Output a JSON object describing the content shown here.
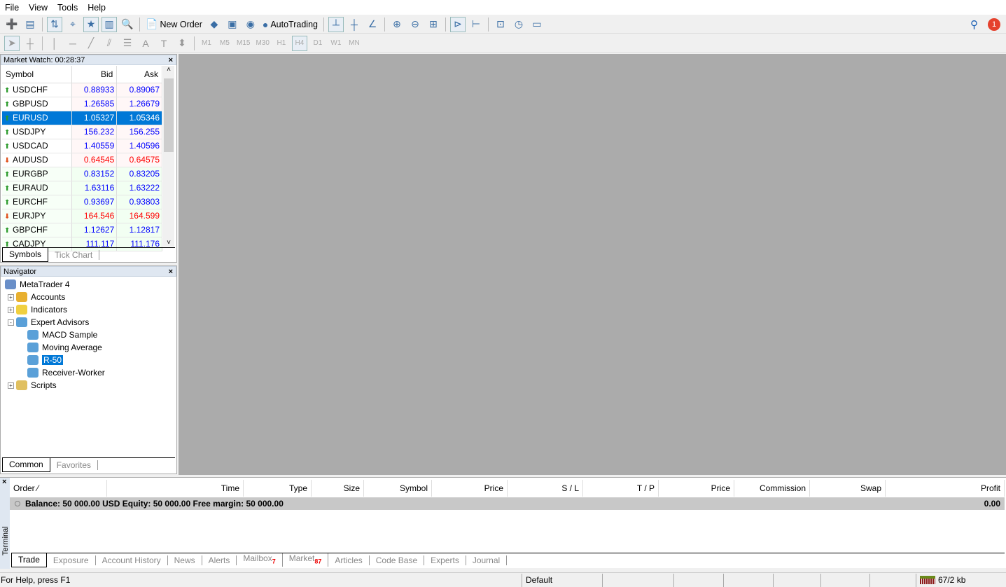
{
  "menu": [
    "File",
    "View",
    "Tools",
    "Help"
  ],
  "toolbar1": [
    {
      "icon": "new-chart-icon",
      "g": "➕"
    },
    {
      "icon": "profiles-icon",
      "g": "▤"
    },
    "sep",
    {
      "icon": "market-watch-icon",
      "g": "⇅",
      "on": true
    },
    {
      "icon": "data-window-icon",
      "g": "⌖"
    },
    {
      "icon": "navigator-icon",
      "g": "★",
      "on": true
    },
    {
      "icon": "terminal-icon",
      "g": "▥",
      "on": true
    },
    {
      "icon": "strategy-tester-icon",
      "g": "🔍"
    },
    "sep",
    {
      "icon": "new-order-icon",
      "g": "📄",
      "label": "New Order"
    },
    {
      "icon": "metaeditor-icon",
      "g": "◆"
    },
    {
      "icon": "options-icon",
      "g": "▣"
    },
    {
      "icon": "signals-icon",
      "g": "◉"
    },
    {
      "icon": "autotrading-icon",
      "g": "●",
      "label": "AutoTrading"
    },
    "sep",
    {
      "icon": "bar-chart-icon",
      "g": "┴",
      "on": true
    },
    {
      "icon": "candlestick-icon",
      "g": "┼"
    },
    {
      "icon": "line-chart-icon",
      "g": "∠"
    },
    "sep",
    {
      "icon": "zoom-in-icon",
      "g": "⊕"
    },
    {
      "icon": "zoom-out-icon",
      "g": "⊖"
    },
    {
      "icon": "tile-windows-icon",
      "g": "⊞"
    },
    "sep",
    {
      "icon": "chart-shift-icon",
      "g": "⊳",
      "on": true
    },
    {
      "icon": "autoscroll-icon",
      "g": "⊢"
    },
    "sep",
    {
      "icon": "indicators-icon",
      "g": "⊡"
    },
    {
      "icon": "periods-icon",
      "g": "◷"
    },
    {
      "icon": "templates-icon",
      "g": "▭"
    }
  ],
  "toolbar2": [
    {
      "icon": "cursor-icon",
      "g": "➤",
      "on": true
    },
    {
      "icon": "crosshair-icon",
      "g": "┼"
    },
    "sep",
    {
      "icon": "vertical-line-icon",
      "g": "│"
    },
    {
      "icon": "horizontal-line-icon",
      "g": "─"
    },
    {
      "icon": "trendline-icon",
      "g": "╱"
    },
    {
      "icon": "equidistant-channel-icon",
      "g": "⫽"
    },
    {
      "icon": "fibonacci-icon",
      "g": "☰"
    },
    {
      "icon": "text-icon",
      "g": "A"
    },
    {
      "icon": "text-label-icon",
      "g": "T"
    },
    {
      "icon": "arrows-icon",
      "g": "⬍"
    },
    "sep",
    {
      "icon": "period-m1",
      "t": "M1"
    },
    {
      "icon": "period-m5",
      "t": "M5"
    },
    {
      "icon": "period-m15",
      "t": "M15"
    },
    {
      "icon": "period-m30",
      "t": "M30"
    },
    {
      "icon": "period-h1",
      "t": "H1"
    },
    {
      "icon": "period-h4",
      "t": "H4",
      "on": true
    },
    {
      "icon": "period-d1",
      "t": "D1"
    },
    {
      "icon": "period-w1",
      "t": "W1"
    },
    {
      "icon": "period-mn",
      "t": "MN"
    }
  ],
  "market_watch": {
    "title": "Market Watch: 00:28:37",
    "columns": [
      "Symbol",
      "Bid",
      "Ask"
    ],
    "rows": [
      {
        "symbol": "USDCHF",
        "bid": "0.88933",
        "ask": "0.89067",
        "dir": "up"
      },
      {
        "symbol": "GBPUSD",
        "bid": "1.26585",
        "ask": "1.26679",
        "dir": "up"
      },
      {
        "symbol": "EURUSD",
        "bid": "1.05327",
        "ask": "1.05346",
        "dir": "up",
        "selected": true
      },
      {
        "symbol": "USDJPY",
        "bid": "156.232",
        "ask": "156.255",
        "dir": "up"
      },
      {
        "symbol": "USDCAD",
        "bid": "1.40559",
        "ask": "1.40596",
        "dir": "up"
      },
      {
        "symbol": "AUDUSD",
        "bid": "0.64545",
        "ask": "0.64575",
        "dir": "down"
      },
      {
        "symbol": "EURGBP",
        "bid": "0.83152",
        "ask": "0.83205",
        "dir": "up"
      },
      {
        "symbol": "EURAUD",
        "bid": "1.63116",
        "ask": "1.63222",
        "dir": "up"
      },
      {
        "symbol": "EURCHF",
        "bid": "0.93697",
        "ask": "0.93803",
        "dir": "up"
      },
      {
        "symbol": "EURJPY",
        "bid": "164.546",
        "ask": "164.599",
        "dir": "down"
      },
      {
        "symbol": "GBPCHF",
        "bid": "1.12627",
        "ask": "1.12817",
        "dir": "up"
      },
      {
        "symbol": "CADJPY",
        "bid": "111.117",
        "ask": "111.176",
        "dir": "up"
      }
    ],
    "tabs": [
      "Symbols",
      "Tick Chart"
    ]
  },
  "navigator": {
    "title": "Navigator",
    "tabs": [
      "Common",
      "Favorites"
    ],
    "items": [
      {
        "label": "MetaTrader 4",
        "level": 0,
        "icon": "metatrader-icon",
        "color": "#6a8fc8"
      },
      {
        "label": "Accounts",
        "level": 1,
        "icon": "accounts-icon",
        "pm": "+",
        "color": "#e8b030"
      },
      {
        "label": "Indicators",
        "level": 1,
        "icon": "indicators-icon",
        "pm": "+",
        "color": "#f0d040"
      },
      {
        "label": "Expert Advisors",
        "level": 1,
        "icon": "expert-advisors-icon",
        "pm": "-",
        "color": "#5aa0d8"
      },
      {
        "label": "MACD Sample",
        "level": 2,
        "icon": "expert-icon",
        "color": "#5aa0d8"
      },
      {
        "label": "Moving Average",
        "level": 2,
        "icon": "expert-icon",
        "color": "#5aa0d8"
      },
      {
        "label": "R-50",
        "level": 2,
        "icon": "expert-icon",
        "color": "#5aa0d8",
        "selected": true
      },
      {
        "label": "Receiver-Worker",
        "level": 2,
        "icon": "expert-icon",
        "color": "#5aa0d8"
      },
      {
        "label": "Scripts",
        "level": 1,
        "icon": "scripts-icon",
        "pm": "+",
        "color": "#e0c060"
      }
    ]
  },
  "terminal": {
    "label": "Terminal",
    "columns": [
      {
        "t": "Order  ⁄",
        "w": 139,
        "a": "left"
      },
      {
        "t": "Time",
        "w": 195
      },
      {
        "t": "Type",
        "w": 97
      },
      {
        "t": "Size",
        "w": 75
      },
      {
        "t": "Symbol",
        "w": 97
      },
      {
        "t": "Price",
        "w": 108
      },
      {
        "t": "S / L",
        "w": 108
      },
      {
        "t": "T / P",
        "w": 108
      },
      {
        "t": "Price",
        "w": 108
      },
      {
        "t": "Commission",
        "w": 108
      },
      {
        "t": "Swap",
        "w": 108
      },
      {
        "t": "Profit",
        "w": 170
      }
    ],
    "balance": "Balance: 50 000.00 USD  Equity: 50 000.00  Free margin: 50 000.00",
    "profit": "0.00",
    "tabs": [
      {
        "t": "Trade"
      },
      {
        "t": "Exposure"
      },
      {
        "t": "Account History"
      },
      {
        "t": "News"
      },
      {
        "t": "Alerts"
      },
      {
        "t": "Mailbox",
        "badge": "7"
      },
      {
        "t": "Market",
        "badge": "87"
      },
      {
        "t": "Articles"
      },
      {
        "t": "Code Base"
      },
      {
        "t": "Experts"
      },
      {
        "t": "Journal"
      }
    ]
  },
  "status": {
    "help": "For Help, press F1",
    "profile": "Default",
    "traffic": "67/2 kb"
  },
  "colors": {
    "up": "#0000ff",
    "down": "#ff0000",
    "selected": "#0078d7",
    "chart_bg": "#ababab"
  }
}
